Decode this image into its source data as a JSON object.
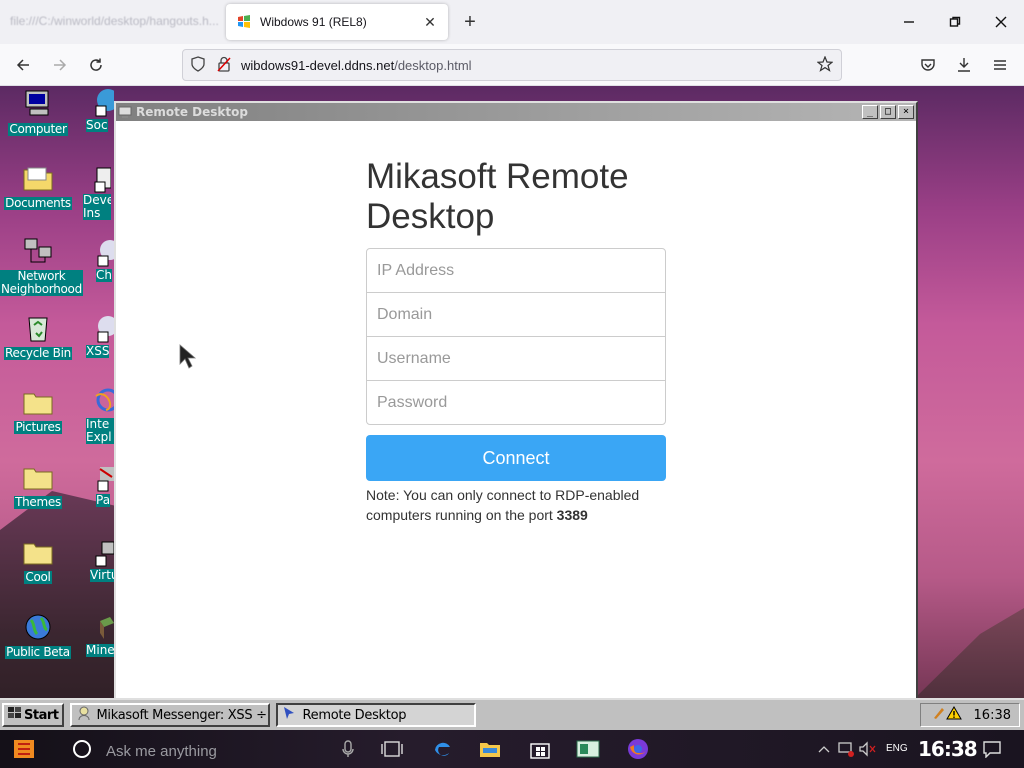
{
  "browser": {
    "bg_tab_title": "file:///C:/winworld/desktop/hangouts.h...",
    "active_tab_title": "Wibdows 91 (REL8)",
    "url_host": "wibdows91-devel.ddns.net",
    "url_path": "/desktop.html"
  },
  "desktop": {
    "icons_left": [
      "Computer",
      "Documents",
      "Network Neighborhood",
      "Recycle Bin",
      "Pictures",
      "Themes",
      "Cool",
      "Public Beta"
    ],
    "icons_right": [
      "Soc",
      "Deve Ins",
      "Ch",
      "XSS",
      "Inte Expl",
      "Pa",
      "Virtu",
      "Mine"
    ]
  },
  "window": {
    "title": "Remote Desktop",
    "heading": "Mikasoft Remote Desktop",
    "fields": {
      "ip_placeholder": "IP Address",
      "domain_placeholder": "Domain",
      "username_placeholder": "Username",
      "password_placeholder": "Password"
    },
    "connect_label": "Connect",
    "note_text": "Note: You can only connect to RDP-enabled computers running on the port ",
    "note_port": "3389"
  },
  "taskbar": {
    "start_label": "Start",
    "items": [
      "Mikasoft Messenger: XSS ÷",
      "Remote Desktop"
    ],
    "clock": "16:38"
  },
  "hostbar": {
    "search_placeholder": "Ask me anything",
    "lang": "ENG",
    "clock": "16:38"
  }
}
